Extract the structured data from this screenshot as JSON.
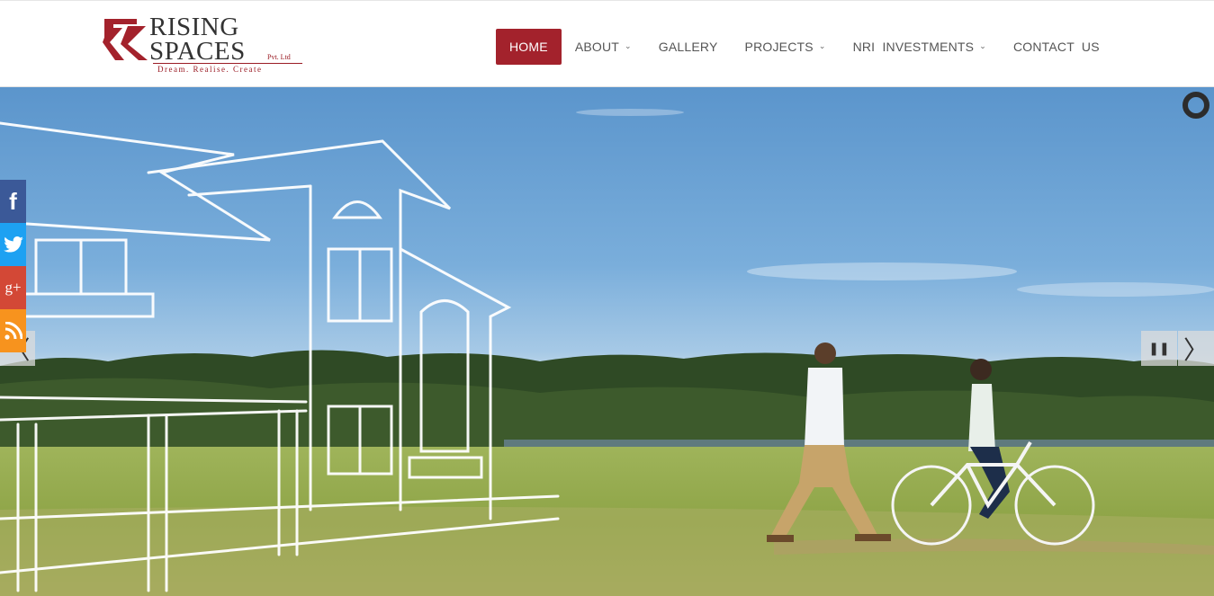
{
  "brand": {
    "name_line1": "RISING",
    "name_line2": "SPACES",
    "suffix": "Pvt. Ltd",
    "tagline": "Dream. Realise. Create",
    "accent": "#a3222c"
  },
  "nav": {
    "items": [
      {
        "label": "HOME",
        "active": true,
        "dropdown": false
      },
      {
        "label": "ABOUT",
        "active": false,
        "dropdown": true
      },
      {
        "label": "GALLERY",
        "active": false,
        "dropdown": false
      },
      {
        "label": "PROJECTS",
        "active": false,
        "dropdown": true
      },
      {
        "label": "NRI  INVESTMENTS",
        "active": false,
        "dropdown": true
      },
      {
        "label": "CONTACT  US",
        "active": false,
        "dropdown": false
      }
    ],
    "chevron": "⌄"
  },
  "slider": {
    "pause_icon": "⏸",
    "next_icon": "〉",
    "prev_icon": "〈"
  },
  "social": {
    "facebook": "f",
    "twitter": "twitter-icon",
    "googleplus": "g+",
    "rss": "rss-icon",
    "colors": {
      "facebook": "#3b5998",
      "twitter": "#1da1f2",
      "googleplus": "#d34836",
      "rss": "#f7931e"
    }
  }
}
